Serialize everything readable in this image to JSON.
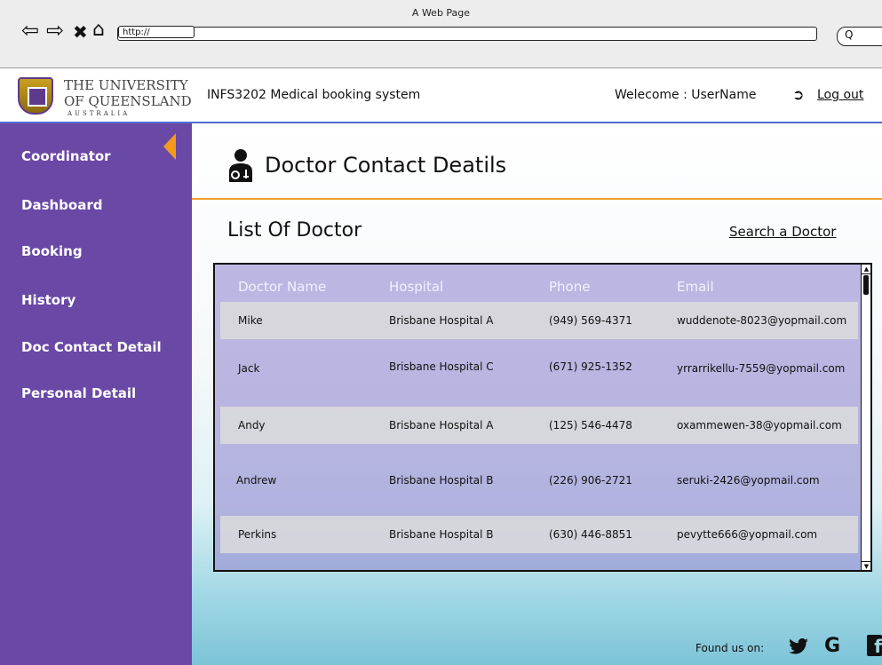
{
  "browser": {
    "window_title": "A Web Page",
    "url": "http://",
    "search_icon_glyph": "Q"
  },
  "header": {
    "logo": {
      "line1": "THE UNIVERSITY",
      "line2": "OF QUEENSLAND",
      "line3": "AUSTRALIA"
    },
    "app_title": "INFS3202 Medical booking system",
    "welcome": "Welecome : UserName",
    "logout": "Log out"
  },
  "sidebar": {
    "items": [
      {
        "label": "Coordinator"
      },
      {
        "label": "Dashboard"
      },
      {
        "label": "Booking"
      },
      {
        "label": "History"
      },
      {
        "label": "Doc Contact Detail"
      },
      {
        "label": "Personal Detail"
      }
    ]
  },
  "main": {
    "page_title": "Doctor Contact Deatils",
    "list_title": "List Of Doctor",
    "search_link": "Search a Doctor",
    "table": {
      "columns": [
        "Doctor Name",
        "Hospital",
        "Phone",
        "Email"
      ],
      "rows": [
        [
          "Mike",
          "Brisbane Hospital A",
          "(949) 569-4371",
          "wuddenote-8023@yopmail.com"
        ],
        [
          "Jack",
          "Brisbane Hospital C",
          "(671) 925-1352",
          "yrrarrikellu-7559@yopmail.com"
        ],
        [
          "Andy",
          "Brisbane Hospital A",
          "(125) 546-4478",
          "oxammewen-38@yopmail.com"
        ],
        [
          "Andrew",
          "Brisbane Hospital B",
          "(226) 906-2721",
          "seruki-2426@yopmail.com"
        ],
        [
          "Perkins",
          "Brisbane Hospital B",
          "(630) 446-8851",
          "pevytte666@yopmail.com"
        ]
      ]
    }
  },
  "footer": {
    "found_us": "Found us on:",
    "social": {
      "twitter": "twitter-icon",
      "google": "G",
      "facebook": "f"
    }
  },
  "colors": {
    "sidebar": "#6a48a6",
    "accent": "#f39a1c",
    "header_rule": "#4d6ed0"
  }
}
